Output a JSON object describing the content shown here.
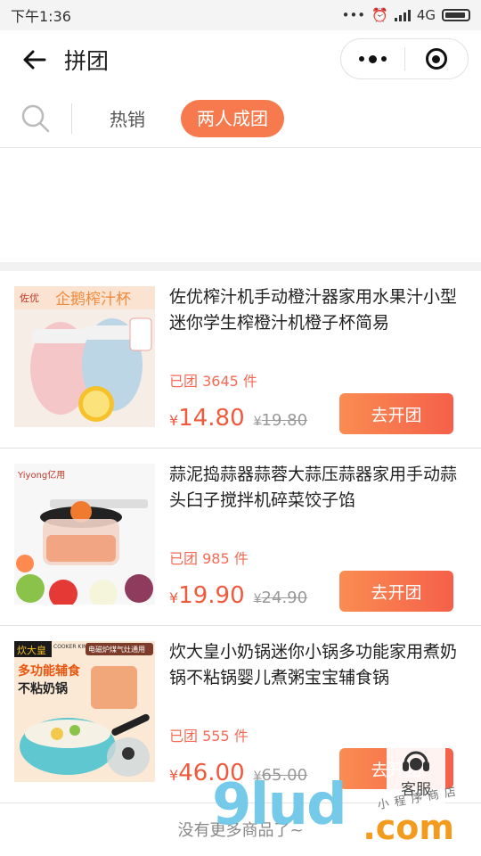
{
  "status_bar": {
    "time": "下午1:36",
    "network": "4G"
  },
  "nav": {
    "title": "拼团"
  },
  "tabs": {
    "hot": "热销",
    "active": "两人成团"
  },
  "products": [
    {
      "title": "佐优榨汁机手动橙汁器家用水果汁小型迷你学生榨橙汁机橙子杯简易",
      "sold": "已团 3645 件",
      "currency": "¥",
      "price": "14.80",
      "orig_price": "19.80",
      "button": "去开团",
      "thumb": {
        "brand": "佐优",
        "banner": "企鹅榨汁杯"
      }
    },
    {
      "title": "蒜泥捣蒜器蒜蓉大蒜压蒜器家用手动蒜头臼子搅拌机碎菜饺子馅",
      "sold": "已团 985 件",
      "currency": "¥",
      "price": "19.90",
      "orig_price": "24.90",
      "button": "去开团",
      "thumb": {
        "brand": "Yiyong亿用"
      }
    },
    {
      "title": "炊大皇小奶锅迷你小锅多功能家用煮奶锅不粘锅婴儿煮粥宝宝辅食锅",
      "sold": "已团 555 件",
      "currency": "¥",
      "price": "46.00",
      "orig_price": "65.00",
      "button": "去开团",
      "thumb": {
        "brand": "炊大皇",
        "brand_en": "COOKER KING",
        "tag": "电磁炉煤气灶通用",
        "line1": "多功能辅食",
        "line2": "不粘奶锅"
      }
    }
  ],
  "footer": {
    "no_more": "没有更多商品了~"
  },
  "service": {
    "label": "客服"
  },
  "watermark": {
    "main": "9lud",
    "sub": "小程序商店",
    "domain": ".com"
  },
  "colors": {
    "accent": "#f77a4e",
    "price": "#f05a3c",
    "sold": "#f76a55"
  }
}
